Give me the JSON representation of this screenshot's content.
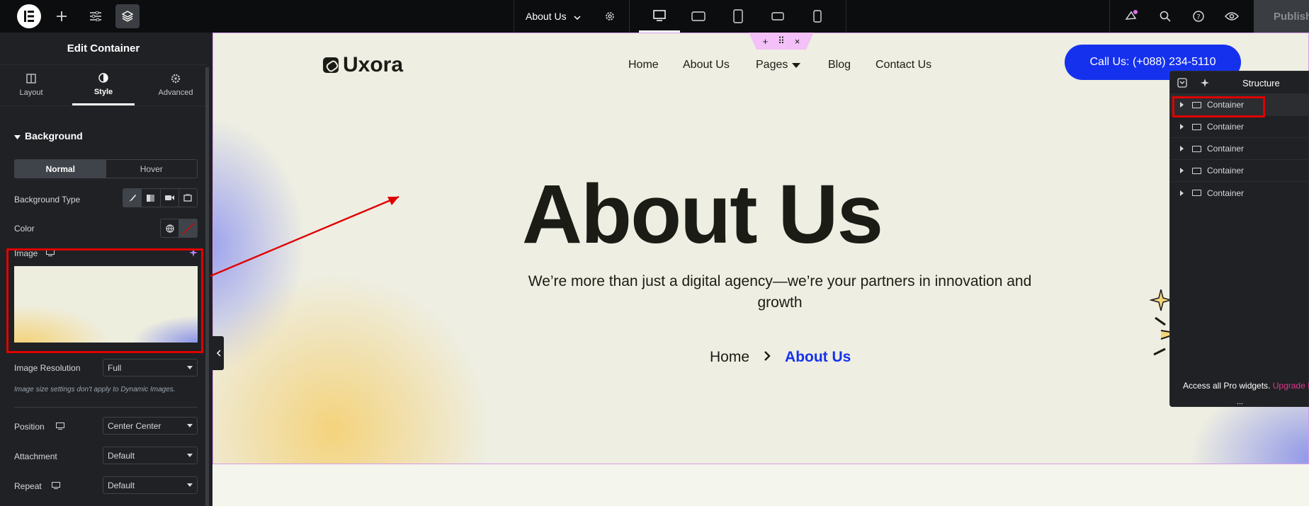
{
  "topbar": {
    "page_title": "About Us",
    "publish_label": "Publish",
    "icons": [
      "elementor-logo-icon",
      "add-icon",
      "settings-sliders-icon",
      "structure-layers-icon",
      "chevron-down-icon",
      "gear-icon",
      "desktop-icon",
      "tablet-landscape-icon",
      "tablet-icon",
      "mobile-landscape-icon",
      "mobile-icon",
      "whats-new-icon",
      "search-icon",
      "help-icon",
      "preview-eye-icon"
    ]
  },
  "panel": {
    "title": "Edit Container",
    "tabs": [
      {
        "label": "Layout",
        "icon": "layout-icon"
      },
      {
        "label": "Style",
        "icon": "style-icon"
      },
      {
        "label": "Advanced",
        "icon": "advanced-gear-icon"
      }
    ],
    "section_title": "Background",
    "state_tabs": {
      "normal": "Normal",
      "hover": "Hover"
    },
    "background_type_label": "Background Type",
    "color_label": "Color",
    "image_label": "Image",
    "image_resolution_label": "Image Resolution",
    "image_resolution_value": "Full",
    "image_note": "Image size settings don't apply to Dynamic Images.",
    "position_label": "Position",
    "position_value": "Center Center",
    "attachment_label": "Attachment",
    "attachment_value": "Default",
    "repeat_label": "Repeat",
    "repeat_value": "Default"
  },
  "site": {
    "brand": "Uxora",
    "nav": [
      "Home",
      "About Us",
      "Pages",
      "Blog",
      "Contact Us"
    ],
    "cta": "Call Us: (+088) 234-5110",
    "heading": "About Us",
    "subtitle": "We’re more than just a digital agency—we’re your partners in innovation and growth",
    "breadcrumb": {
      "home": "Home",
      "current": "About Us"
    },
    "handle_icons": {
      "add": "+",
      "move": "⠿",
      "close": "×"
    }
  },
  "structure": {
    "title": "Structure",
    "items": [
      "Container",
      "Container",
      "Container",
      "Container",
      "Container"
    ],
    "pro_text": "Access all Pro widgets.",
    "upgrade_text": "Upgrade N",
    "more": "..."
  },
  "colors": {
    "accent_blue": "#1531ee",
    "highlight_red": "#e00000",
    "panel_bg": "#1f2124"
  }
}
